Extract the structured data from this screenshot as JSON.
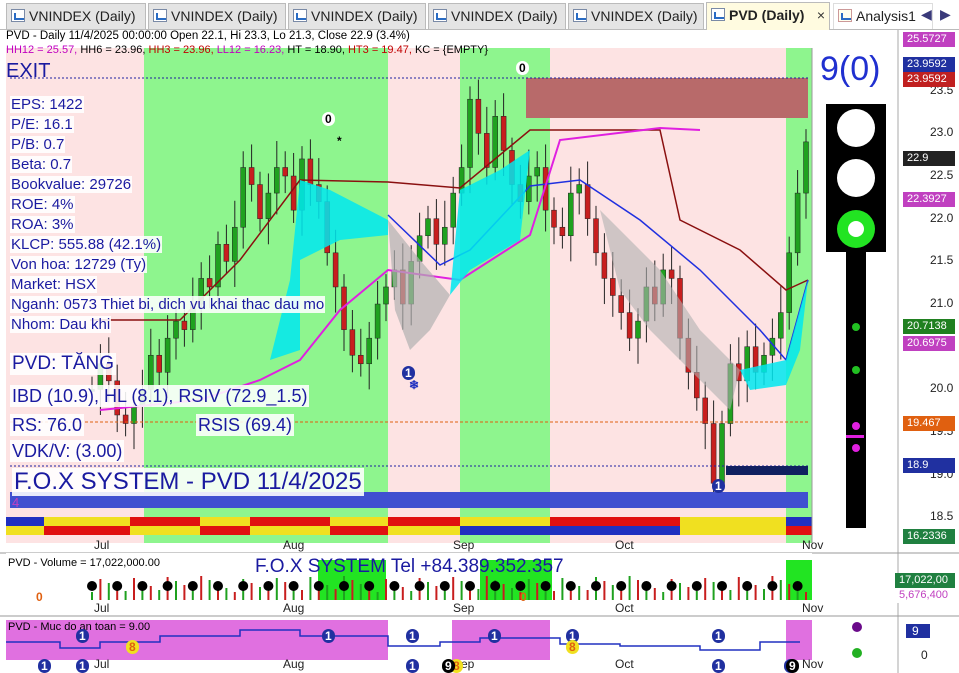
{
  "tabs": [
    {
      "label": "VNINDEX (Daily)",
      "active": false
    },
    {
      "label": "VNINDEX (Daily)",
      "active": false
    },
    {
      "label": "VNINDEX (Daily)",
      "active": false
    },
    {
      "label": "VNINDEX (Daily)",
      "active": false
    },
    {
      "label": "VNINDEX (Daily)",
      "active": false
    },
    {
      "label": "PVD (Daily)",
      "active": true
    },
    {
      "label": "Analysis1",
      "active": false
    }
  ],
  "tab_close": "×",
  "nav": {
    "left": "◀",
    "right": "▶"
  },
  "header": {
    "line1": "PVD - Daily 11/4/2025 00:00:00 Open 22.1, Hi 23.3, Lo 21.3, Close 22.9 (3.4%)",
    "line2_parts": [
      {
        "text": "HH12 = 25.57, ",
        "color": "#c000c0"
      },
      {
        "text": "HH6 = 23.96, ",
        "color": "#000000"
      },
      {
        "text": "HH3 = 23.96, ",
        "color": "#c00000"
      },
      {
        "text": "LL12 = 16.23, ",
        "color": "#c000c0"
      },
      {
        "text": "HT = 18.90, ",
        "color": "#000000"
      },
      {
        "text": "HT3 = 19.47, ",
        "color": "#c00000"
      },
      {
        "text": "KC = {EMPTY}",
        "color": "#000000"
      }
    ]
  },
  "exit_label": "EXIT",
  "fundamentals": [
    "EPS: 1422",
    "P/E: 16.1",
    "P/B: 0.7",
    "Beta: 0.7",
    "Bookvalue: 29726",
    "ROE: 4%",
    "ROA: 3%",
    "KLCP: 555.88 (42.1%)",
    "Von hoa: 12729 (Ty)",
    "Market: HSX",
    "Nganh: 0573 Thiet bi, dich vu khai thac dau mo",
    "Nhom: Dau khi"
  ],
  "trend_label": "PVD: TĂNG",
  "indicators": {
    "ibd": "IBD (10.9), HL (8.1), RSIV (72.9_1.5)",
    "rs": "RS: 76.0",
    "rsis": "RSIS (69.4)",
    "vdk": "VDK/V:  (3.00)"
  },
  "system_title": "F.O.X SYSTEM - PVD 11/4/2025",
  "small_four": "4",
  "signal_text": "9(0)",
  "price_axis": [
    "23.5",
    "23.0",
    "22.5",
    "22.0",
    "21.5",
    "21.0",
    "20.5",
    "20.0",
    "19.5",
    "19.0",
    "18.5"
  ],
  "price_tags": [
    {
      "text": "25.5727",
      "color": "#c040c0"
    },
    {
      "text": "23.9592",
      "color": "#2030a0"
    },
    {
      "text": "23.9592",
      "color": "#c02020"
    },
    {
      "text": "22.9",
      "color": "#222222"
    },
    {
      "text": "22.3927",
      "color": "#c040c0"
    },
    {
      "text": "20.7138",
      "color": "#208020"
    },
    {
      "text": "20.6975",
      "color": "#c040c0"
    },
    {
      "text": "19.467",
      "color": "#e06010"
    },
    {
      "text": "18.9",
      "color": "#2030a0"
    },
    {
      "text": "16.2336",
      "color": "#208040"
    }
  ],
  "months": [
    "Jul",
    "Aug",
    "Sep",
    "Oct",
    "Nov"
  ],
  "volume": {
    "label": "PVD - Volume = 17,022,000.00",
    "phone": "F.O.X SYSTEM Tel +84.389.352.357",
    "tags": [
      "17,022,00",
      "5,676,400"
    ]
  },
  "safety": {
    "label": "PVD - Muc do an toan = 9.00",
    "tag": "9",
    "axis": "0"
  },
  "signals": {
    "zero_mark": "0",
    "one_mark": "1",
    "eight_mark": "8",
    "nine_mark": "9",
    "star": "*",
    "snow": "❄"
  },
  "colors": {
    "green_zone": "#8ef58e",
    "pink_zone": "#fde3e3",
    "cyan": "#00e8f0",
    "candle_up": "#1fa11f",
    "candle_down": "#c81e1e"
  },
  "chart_data": {
    "type": "candlestick",
    "symbol": "PVD",
    "period": "Daily",
    "last_bar": {
      "date": "11/4/2025",
      "open": 22.1,
      "high": 23.3,
      "low": 21.3,
      "close": 22.9,
      "change_pct": 3.4
    },
    "y_ticks": [
      18.5,
      19.0,
      19.5,
      20.0,
      20.5,
      21.0,
      21.5,
      22.0,
      22.5,
      23.0,
      23.5
    ],
    "ylim": [
      18.2,
      24.0
    ],
    "x_ticks": [
      "Jul",
      "Aug",
      "Sep",
      "Oct",
      "Nov"
    ],
    "close_series": [
      20.0,
      20.3,
      20.1,
      19.7,
      19.6,
      19.8,
      20.0,
      20.4,
      20.2,
      20.6,
      20.8,
      20.7,
      21.0,
      21.3,
      21.2,
      21.7,
      21.5,
      21.9,
      22.6,
      22.4,
      22.0,
      22.3,
      22.6,
      22.5,
      22.1,
      22.7,
      22.4,
      22.2,
      21.6,
      21.2,
      20.7,
      20.4,
      20.3,
      20.6,
      21.0,
      21.2,
      21.4,
      21.0,
      21.5,
      21.8,
      22.0,
      21.7,
      21.9,
      22.3,
      22.6,
      23.4,
      23.0,
      22.6,
      23.2,
      22.8,
      22.4,
      22.2,
      22.5,
      22.6,
      22.1,
      21.9,
      21.8,
      22.3,
      22.4,
      22.0,
      21.6,
      21.3,
      21.1,
      20.9,
      20.6,
      20.8,
      21.2,
      21.0,
      21.4,
      21.3,
      20.6,
      20.2,
      19.9,
      19.6,
      18.9,
      19.6,
      20.3,
      20.1,
      20.5,
      20.2,
      20.4,
      20.6,
      20.9,
      21.6,
      22.3,
      22.9
    ]
  }
}
